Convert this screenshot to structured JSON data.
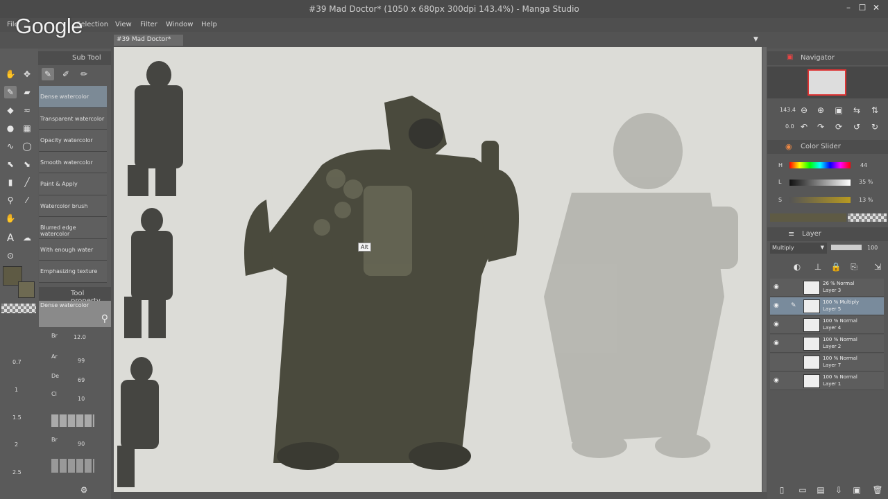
{
  "window": {
    "title": "#39 Mad Doctor* (1050 x 680px 300dpi 143.4%) - Manga Studio",
    "watermark": "Google"
  },
  "menu": [
    "File",
    "Selection",
    "View",
    "Filter",
    "Window",
    "Help"
  ],
  "canvas_tab": "#39 Mad Doctor*",
  "subtool": {
    "header": "Sub Tool",
    "items": [
      "Dense watercolor",
      "Transparent watercolor",
      "Opacity watercolor",
      "Smooth watercolor",
      "Paint & Apply",
      "Watercolor brush",
      "Blurred edge watercolor",
      "With enough water",
      "Emphasizing texture"
    ],
    "selected": "Dense watercolor"
  },
  "tool_property": {
    "header": "Tool property",
    "preset": "Dense watercolor",
    "rows": [
      {
        "label": "Br",
        "value": "12.0"
      },
      {
        "label": "Ar",
        "value": "99"
      },
      {
        "label": "De",
        "value": "69"
      },
      {
        "label": "Cl",
        "value": "10"
      },
      {
        "label": "Br",
        "value": "90"
      }
    ]
  },
  "size_values": [
    "0.7",
    "1",
    "1.5",
    "2",
    "2.5"
  ],
  "navigator": {
    "header": "Navigator",
    "zoom": "143.4",
    "rotation": "0.0"
  },
  "color_slider": {
    "header": "Color Slider",
    "h": {
      "label": "H",
      "value": "44"
    },
    "l": {
      "label": "L",
      "value": "35 %"
    },
    "s": {
      "label": "S",
      "value": "13 %"
    }
  },
  "layer_panel": {
    "header": "Layer",
    "blend_mode": "Multiply",
    "opacity": "100",
    "layers": [
      {
        "opacity": "26 %",
        "mode": "Normal",
        "name": "Layer 3",
        "visible": true
      },
      {
        "opacity": "100 %",
        "mode": "Multiply",
        "name": "Layer 5",
        "visible": true,
        "selected": true
      },
      {
        "opacity": "100 %",
        "mode": "Normal",
        "name": "Layer 4",
        "visible": true
      },
      {
        "opacity": "100 %",
        "mode": "Normal",
        "name": "Layer 2",
        "visible": true
      },
      {
        "opacity": "100 %",
        "mode": "Normal",
        "name": "Layer 7",
        "visible": false
      },
      {
        "opacity": "100 %",
        "mode": "Normal",
        "name": "Layer 1",
        "visible": true
      }
    ]
  },
  "cursor_tooltip": "Alt"
}
